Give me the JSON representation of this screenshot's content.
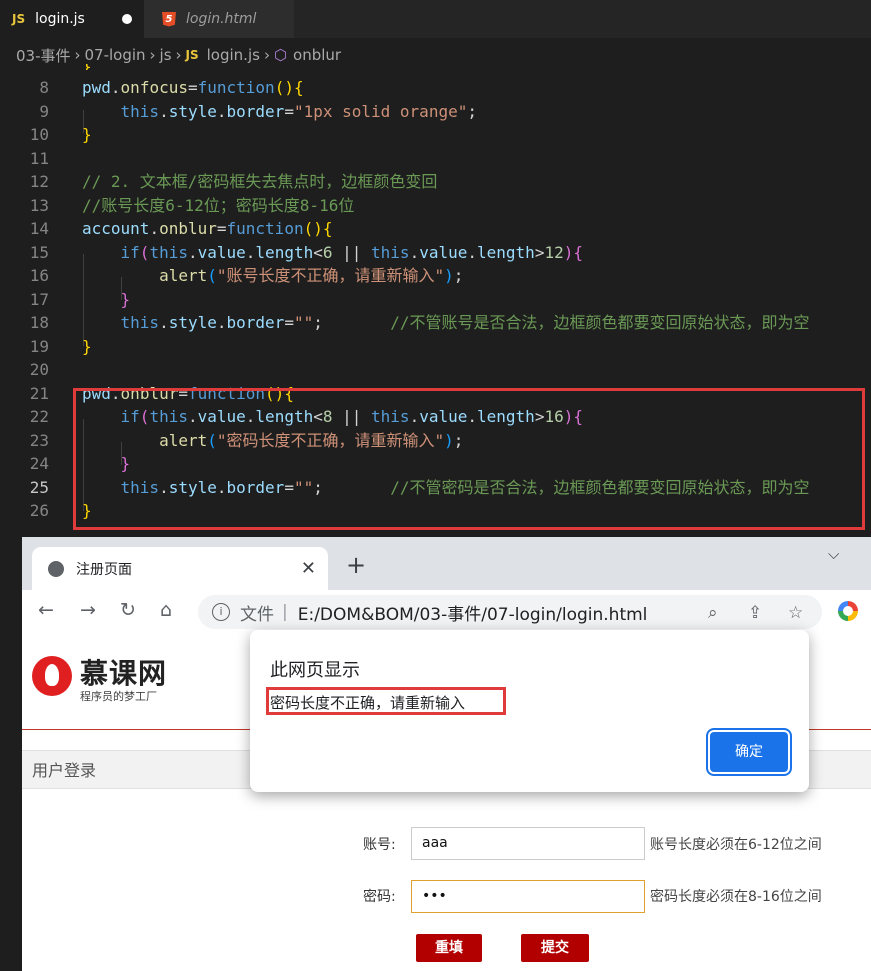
{
  "editor": {
    "tabs": [
      {
        "icon": "JS",
        "label": "login.js",
        "modified": true
      },
      {
        "icon": "5",
        "label": "login.html"
      }
    ],
    "breadcrumb": [
      "03-事件",
      "07-login",
      "js",
      "login.js",
      "onblur"
    ],
    "breadcrumb_js_icon": "JS",
    "lines": [
      {
        "num": "8",
        "tokens": [
          [
            "v",
            "pwd"
          ],
          [
            "p",
            "."
          ],
          [
            "f",
            "onfocus"
          ],
          [
            "p",
            "="
          ],
          [
            "k",
            "function"
          ],
          [
            "br",
            "(){"
          ]
        ]
      },
      {
        "num": "9",
        "tokens": [
          [
            "p",
            "    "
          ],
          [
            "k",
            "this"
          ],
          [
            "p",
            "."
          ],
          [
            "v",
            "style"
          ],
          [
            "p",
            "."
          ],
          [
            "v",
            "border"
          ],
          [
            "p",
            "="
          ],
          [
            "s",
            "\"1px solid orange\""
          ],
          [
            "p",
            ";"
          ]
        ]
      },
      {
        "num": "10",
        "tokens": [
          [
            "br",
            "}"
          ]
        ]
      },
      {
        "num": "11",
        "tokens": []
      },
      {
        "num": "12",
        "tokens": [
          [
            "c",
            "// 2. 文本框/密码框失去焦点时，边框颜色变回"
          ]
        ]
      },
      {
        "num": "13",
        "tokens": [
          [
            "c",
            "//账号长度6-12位；密码长度8-16位"
          ]
        ]
      },
      {
        "num": "14",
        "tokens": [
          [
            "v",
            "account"
          ],
          [
            "p",
            "."
          ],
          [
            "f",
            "onblur"
          ],
          [
            "p",
            "="
          ],
          [
            "k",
            "function"
          ],
          [
            "br",
            "(){"
          ]
        ]
      },
      {
        "num": "15",
        "tokens": [
          [
            "p",
            "    "
          ],
          [
            "k",
            "if"
          ],
          [
            "bp",
            "("
          ],
          [
            "k",
            "this"
          ],
          [
            "p",
            "."
          ],
          [
            "v",
            "value"
          ],
          [
            "p",
            "."
          ],
          [
            "v",
            "length"
          ],
          [
            "p",
            "<"
          ],
          [
            "n",
            "6"
          ],
          [
            "p",
            " || "
          ],
          [
            "k",
            "this"
          ],
          [
            "p",
            "."
          ],
          [
            "v",
            "value"
          ],
          [
            "p",
            "."
          ],
          [
            "v",
            "length"
          ],
          [
            "p",
            ">"
          ],
          [
            "n",
            "12"
          ],
          [
            "bp",
            ")"
          ],
          [
            "bp",
            "{"
          ]
        ]
      },
      {
        "num": "16",
        "tokens": [
          [
            "p",
            "        "
          ],
          [
            "f",
            "alert"
          ],
          [
            "bb",
            "("
          ],
          [
            "s",
            "\"账号长度不正确，请重新输入\""
          ],
          [
            "bb",
            ")"
          ],
          [
            "p",
            ";"
          ]
        ]
      },
      {
        "num": "17",
        "tokens": [
          [
            "p",
            "    "
          ],
          [
            "bp",
            "}"
          ]
        ]
      },
      {
        "num": "18",
        "tokens": [
          [
            "p",
            "    "
          ],
          [
            "k",
            "this"
          ],
          [
            "p",
            "."
          ],
          [
            "v",
            "style"
          ],
          [
            "p",
            "."
          ],
          [
            "v",
            "border"
          ],
          [
            "p",
            "="
          ],
          [
            "s",
            "\"\""
          ],
          [
            "p",
            ";       "
          ],
          [
            "c",
            "//不管账号是否合法，边框颜色都要变回原始状态，即为空"
          ]
        ]
      },
      {
        "num": "19",
        "tokens": [
          [
            "br",
            "}"
          ]
        ]
      },
      {
        "num": "20",
        "tokens": []
      },
      {
        "num": "21",
        "tokens": [
          [
            "v",
            "pwd"
          ],
          [
            "p",
            "."
          ],
          [
            "f",
            "onblur"
          ],
          [
            "p",
            "="
          ],
          [
            "k",
            "function"
          ],
          [
            "br",
            "(){"
          ]
        ]
      },
      {
        "num": "22",
        "tokens": [
          [
            "p",
            "    "
          ],
          [
            "k",
            "if"
          ],
          [
            "bp",
            "("
          ],
          [
            "k",
            "this"
          ],
          [
            "p",
            "."
          ],
          [
            "v",
            "value"
          ],
          [
            "p",
            "."
          ],
          [
            "v",
            "length"
          ],
          [
            "p",
            "<"
          ],
          [
            "n",
            "8"
          ],
          [
            "p",
            " || "
          ],
          [
            "k",
            "this"
          ],
          [
            "p",
            "."
          ],
          [
            "v",
            "value"
          ],
          [
            "p",
            "."
          ],
          [
            "v",
            "length"
          ],
          [
            "p",
            ">"
          ],
          [
            "n",
            "16"
          ],
          [
            "bp",
            ")"
          ],
          [
            "bp",
            "{"
          ]
        ]
      },
      {
        "num": "23",
        "tokens": [
          [
            "p",
            "        "
          ],
          [
            "f",
            "alert"
          ],
          [
            "bb",
            "("
          ],
          [
            "s",
            "\"密码长度不正确，请重新输入\""
          ],
          [
            "bb",
            ")"
          ],
          [
            "p",
            ";"
          ]
        ]
      },
      {
        "num": "24",
        "tokens": [
          [
            "p",
            "    "
          ],
          [
            "bp",
            "}"
          ]
        ]
      },
      {
        "num": "25",
        "tokens": [
          [
            "p",
            "    "
          ],
          [
            "k",
            "this"
          ],
          [
            "p",
            "."
          ],
          [
            "v",
            "style"
          ],
          [
            "p",
            "."
          ],
          [
            "v",
            "border"
          ],
          [
            "p",
            "="
          ],
          [
            "s",
            "\"\""
          ],
          [
            "p",
            ";       "
          ],
          [
            "c",
            "//不管密码是否合法，边框颜色都要变回原始状态，即为空"
          ]
        ]
      },
      {
        "num": "26",
        "tokens": [
          [
            "br",
            "}"
          ]
        ]
      }
    ],
    "current_line": "25"
  },
  "browser": {
    "tab_title": "注册页面",
    "address_prefix": "文件",
    "address": "E:/DOM&BOM/03-事件/07-login/login.html",
    "page": {
      "logo_name": "慕课网",
      "logo_slogan": "程序员的梦工厂",
      "section_title": "用户登录",
      "account_label": "账号:",
      "account_value": "aaa",
      "account_hint": "账号长度必须在6-12位之间",
      "password_label": "密码:",
      "password_value": "•••",
      "password_hint": "密码长度必须在8-16位之间",
      "reset_label": "重填",
      "submit_label": "提交"
    }
  },
  "dialog": {
    "title": "此网页显示",
    "message": "密码长度不正确，请重新输入",
    "ok_label": "确定"
  },
  "colors": {
    "highlight_box": "#e03b3b",
    "primary_button": "#1a73e8",
    "brand_red": "#b20000"
  }
}
